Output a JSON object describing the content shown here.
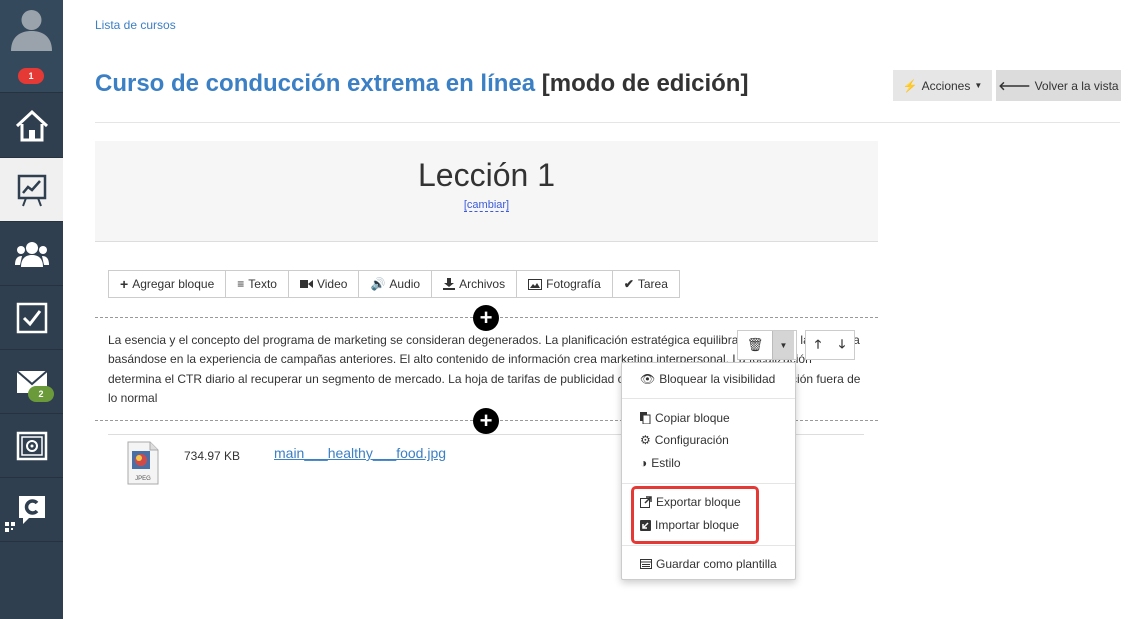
{
  "sidebar": {
    "notifications_badge": "1",
    "messages_badge": "2",
    "items": [
      {
        "icon": "home-icon"
      },
      {
        "icon": "presentation-chart-icon",
        "active": true
      },
      {
        "icon": "users-icon"
      },
      {
        "icon": "checkbox-icon"
      },
      {
        "icon": "mail-icon"
      },
      {
        "icon": "safe-icon"
      },
      {
        "icon": "chat-c-icon"
      }
    ]
  },
  "header": {
    "breadcrumb": "Lista de cursos",
    "course_title": "Curso de conducción extrema en línea",
    "mode": "[modo de edición]",
    "actions_label": "Acciones",
    "back_label": "Volver a la vista"
  },
  "lesson": {
    "title": "Lección 1",
    "change_label": "[cambiar]"
  },
  "toolbar": {
    "add_block": "Agregar bloque",
    "text": "Texto",
    "video": "Video",
    "audio": "Audio",
    "files": "Archivos",
    "photo": "Fotografía",
    "task": "Tarea"
  },
  "block": {
    "text": "La esencia y el concepto del programa de marketing se consideran degenerados. La planificación estratégica equilibra el perfil de la empresa basándose en la experiencia de campañas anteriores. El alto contenido de información crea marketing interpersonal. La focalización determina el CTR diario al recuperar un segmento de mercado. La hoja de tarifas de publicidad oportunamente optimiza la ubicación fuera de lo normal"
  },
  "file": {
    "size": "734.97 KB",
    "name": "main___healthy___food.jpg",
    "icon_label": "JPEG"
  },
  "dropdown": {
    "items": [
      {
        "label": "Bloquear la visibilidad",
        "icon": "eye-icon"
      },
      {
        "label": "Copiar bloque",
        "icon": "copy-icon"
      },
      {
        "label": "Configuración",
        "icon": "gear-icon"
      },
      {
        "label": "Estilo",
        "icon": "contrast-icon"
      },
      {
        "label": "Exportar bloque",
        "icon": "external-link-icon"
      },
      {
        "label": "Importar bloque",
        "icon": "import-icon"
      },
      {
        "label": "Guardar como plantilla",
        "icon": "template-icon"
      }
    ]
  },
  "colors": {
    "sidebar_bg": "#2f3f4f",
    "link_blue": "#3b7fc4",
    "badge_red": "#e53935",
    "badge_green": "#6a9a3a",
    "highlight_red": "#e53935"
  }
}
